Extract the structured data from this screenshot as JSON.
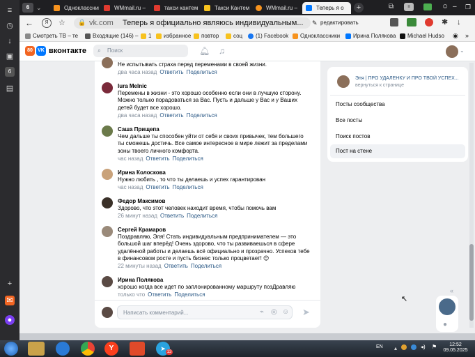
{
  "browser": {
    "tab_count": "6",
    "tabs": [
      {
        "label": "Одноклассники",
        "color": "#f7931e"
      },
      {
        "label": "WMmail.ru –",
        "color": "#e03a2f"
      },
      {
        "label": "такси кантем",
        "color": "#e03a2f"
      },
      {
        "label": "Такси Кантем",
        "color": "#f7c21e"
      },
      {
        "label": "WMmail.ru –",
        "color": "#f7931e"
      },
      {
        "label": "Теперь я о",
        "color": "#0077ff"
      }
    ],
    "url_domain": "vk.com",
    "page_title": "Теперь я официально являюсь индивидуальным...",
    "translate_label": "редактировать",
    "bookmarks": [
      {
        "label": "Смотреть ТВ – те",
        "color": "#8a8a8a"
      },
      {
        "label": "Входящие (146) –",
        "color": "#555555"
      },
      {
        "label": "1",
        "color": "#f7c21e"
      },
      {
        "label": "избранное",
        "color": "#f7c21e"
      },
      {
        "label": "повтор",
        "color": "#f7c21e"
      },
      {
        "label": "соц",
        "color": "#f7c21e"
      },
      {
        "label": "(1) Facebook",
        "color": "#1877f2"
      },
      {
        "label": "Одноклассники",
        "color": "#f7931e"
      },
      {
        "label": "Ирина Полякова",
        "color": "#0077ff"
      },
      {
        "label": "Michael Hudso",
        "color": "#111111"
      }
    ]
  },
  "vk": {
    "badge": "80",
    "logo": "вконтакте",
    "search_placeholder": "Поиск"
  },
  "comments": [
    {
      "name": "",
      "text": "Не испытывать страха перед переменами в своей жизни.",
      "time": "два часа назад",
      "reply": "Ответить",
      "share": "Поделиться",
      "avatar": "#8b6f5a"
    },
    {
      "name": "Iura Melnic",
      "text": "Перемены в жизни - это хорошо особенно если они в лучшую сторону. Можно только порадоваться за Вас. Пусть и дальше у Вас и у Ваших детей будет все хорошо.",
      "time": "два часа назад",
      "reply": "Ответить",
      "share": "Поделиться",
      "avatar": "#7a2a3a"
    },
    {
      "name": "Саша Прищепа",
      "text": "Чем дальше ты способен уйти от себя и своих привычек, тем большего ты сможешь достичь. Все самое интересное в мире лежит за пределами зоны твоего личного комфорта.",
      "time": "час назад",
      "reply": "Ответить",
      "share": "Поделиться",
      "avatar": "#6b7a4a"
    },
    {
      "name": "Ирина Колоскова",
      "text": "Нужно любить , то что ты делаешь и успех гарантирован",
      "time": "час назад",
      "reply": "Ответить",
      "share": "Поделиться",
      "avatar": "#c9a27a"
    },
    {
      "name": "Федор Максимов",
      "text": "Здорово, что этот человек находит время, чтобы помочь вам",
      "time": "26 минут назад",
      "reply": "Ответить",
      "share": "Поделиться",
      "avatar": "#3a3028"
    },
    {
      "name": "Сергей Крамаров",
      "text": "Поздравляю, Эля! Стать индивидуальным предпринимателем — это большой шаг вперёд! Очень здорово, что ты развиваешься в сфере удалённой работы и делаешь всё официально и прозрачно. Успехов тебе в финансовом росте и пусть бизнес только процветает! 😊",
      "time": "22 минуты назад",
      "reply": "Ответить",
      "share": "Поделиться",
      "avatar": "#9a8a7a"
    },
    {
      "name": "Ирина Полякова",
      "text": "хорошо когда все идет по заплонированному маршруту позДравляю",
      "time": "только что",
      "reply": "Ответить",
      "share": "Поделиться",
      "avatar": "#5a4a44"
    }
  ],
  "composer": {
    "placeholder": "Написать комментарий..."
  },
  "sidebar": {
    "community": "Эля | ПРО УДАЛЕНКУ И ПРО ТВОЙ УСПЕХ...",
    "back": "вернуться к странице",
    "items": [
      "Посты сообщества",
      "Все посты",
      "Поиск постов",
      "Пост на стене"
    ]
  },
  "taskbar": {
    "lang": "EN",
    "time": "12:52",
    "date": "09.05.2025",
    "telegram_badge": "13"
  }
}
